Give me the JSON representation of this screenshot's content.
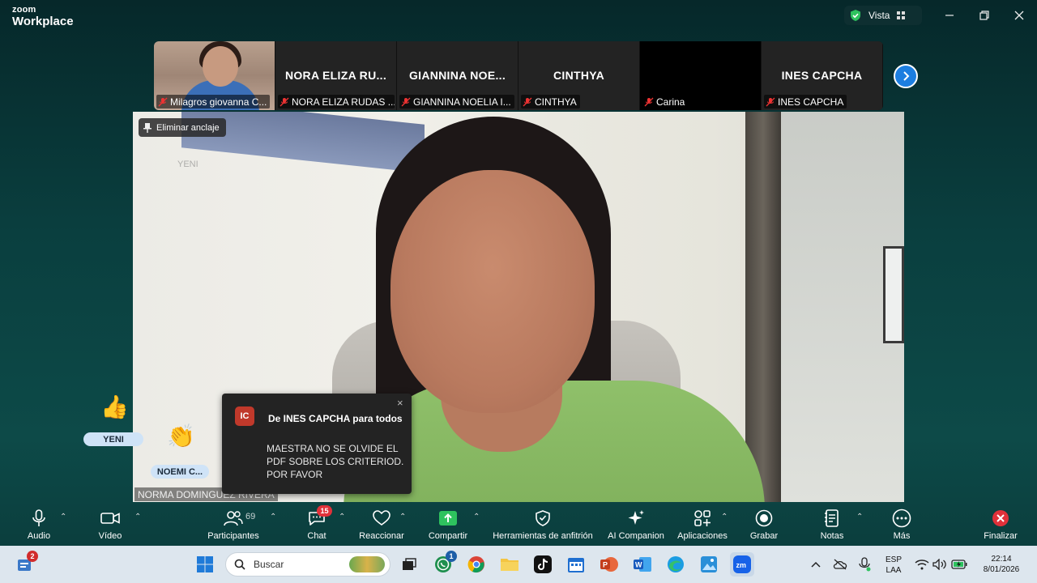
{
  "app": {
    "brand_small": "zoom",
    "brand_large": "Workplace",
    "view_label": "Vista"
  },
  "thumbnails": [
    {
      "big_name": "",
      "label": "Milagros giovanna C...",
      "type": "photo"
    },
    {
      "big_name": "NORA ELIZA RU...",
      "label": "NORA ELIZA RUDAS ...",
      "type": "name"
    },
    {
      "big_name": "GIANNINA NOE...",
      "label": "GIANNINA NOELIA I...",
      "type": "name"
    },
    {
      "big_name": "CINTHYA",
      "label": "CINTHYA",
      "type": "name"
    },
    {
      "big_name": "",
      "label": "Carina",
      "type": "black"
    },
    {
      "big_name": "INES CAPCHA",
      "label": "INES CAPCHA",
      "type": "name"
    }
  ],
  "main_video": {
    "unpin_label": "Eliminar anclaje",
    "ghost_label": "YENI",
    "speaker_name": "NORMA DOMINGUEZ RIVERA"
  },
  "reactions": [
    {
      "emoji": "👍",
      "name": "YENI"
    },
    {
      "emoji": "👏",
      "name": "NOEMI  C..."
    }
  ],
  "chat_popup": {
    "avatar_initials": "IC",
    "from": "De INES CAPCHA para todos",
    "message": "MAESTRA NO SE OLVIDE EL PDF SOBRE LOS CRITERIOD. POR FAVOR",
    "close": "×"
  },
  "toolbar": {
    "audio": "Audio",
    "video": "Vídeo",
    "participants": "Participantes",
    "participants_count": "69",
    "chat": "Chat",
    "chat_badge": "15",
    "react": "Reaccionar",
    "share": "Compartir",
    "host_tools": "Herramientas de anfitrión",
    "ai": "AI Companion",
    "apps": "Aplicaciones",
    "record": "Grabar",
    "notes": "Notas",
    "more": "Más",
    "end": "Finalizar"
  },
  "taskbar": {
    "widget_badge": "2",
    "search_placeholder": "Buscar",
    "whatsapp_badge": "1",
    "lang_top": "ESP",
    "lang_bottom": "LAA",
    "time": "22:14",
    "date": "8/01/2026"
  },
  "colors": {
    "accent": "#1c7ee0",
    "end_red": "#e0313a",
    "share_green": "#2ec25e"
  }
}
